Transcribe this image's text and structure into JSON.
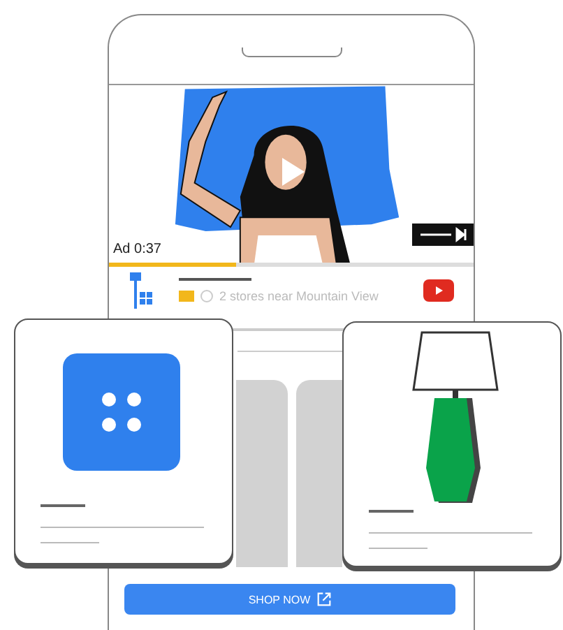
{
  "video": {
    "ad_label": "Ad 0:37",
    "progress": {
      "level": 0.35
    }
  },
  "ad_info": {
    "text": "2 stores near Mountain View"
  },
  "cta": {
    "label": "SHOP NOW"
  },
  "product_cards": [
    {
      "kind": "app"
    },
    {
      "kind": "lamp"
    }
  ]
}
